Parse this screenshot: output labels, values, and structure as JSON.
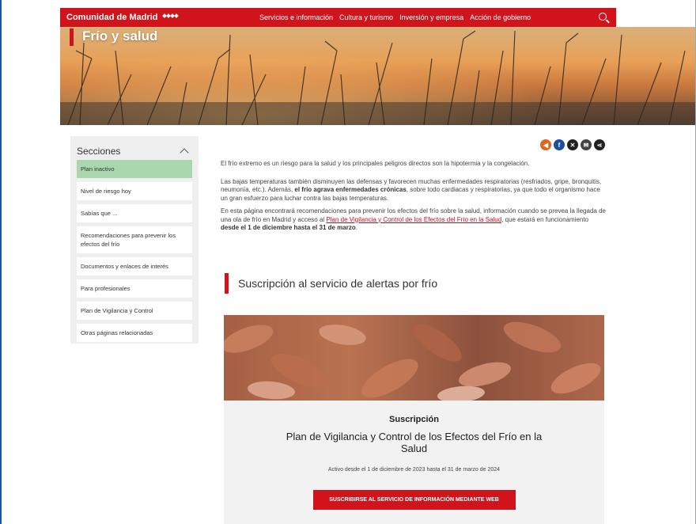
{
  "header": {
    "brand": "Comunidad de Madrid",
    "nav": [
      "Servicios e información",
      "Cultura y turismo",
      "Inversión y empresa",
      "Acción de gobierno"
    ]
  },
  "hero": {
    "title": "Frío y salud"
  },
  "sidebar": {
    "title": "Secciones",
    "items": [
      "Plan inactivo",
      "Nivel de riesgo hoy",
      "Sabías que ...",
      "Recomendaciones para prevenir los efectos del frío",
      "Documentos y enlaces de interés",
      "Para profesionales",
      "Plan de Vigilancia y Control",
      "Otras páginas relacionadas"
    ]
  },
  "content": {
    "p1": "El frío extremo es un riesgo para la salud y los principales peligros directos son la hipotermia y la congelación.",
    "p2_a": "Las bajas temperaturas también disminuyen las defensas y favorecen muchas enfermedades respiratorias (resfriados, gripe, bronquitis, neumonía, etc.). Además, ",
    "p2_b": "el frío agrava enfermedades crónicas",
    "p2_c": ", sobre todo cardiacas y respiratorias, ya que todo el organismo hace un gran esfuerzo para luchar contra las bajas temperaturas.",
    "p3_a": "En esta página encontrará recomendaciones para prevenir los efectos del frío sobre la salud, información cuando se prevea la llegada de una ola de frío en Madrid y acceso al ",
    "p3_link": "Plan de Vigilancia y Control de los Efectos del Frío en la Salud",
    "p3_b": ", que estará en funcionamiento ",
    "p3_c": "desde el 1 de diciembre hasta el 31 de marzo",
    "p3_d": ".",
    "subscription_title": "Suscripción al servicio de alertas por frío"
  },
  "card": {
    "kicker": "Suscripción",
    "title": "Plan de Vigilancia y Control de los Efectos del Frío en la Salud",
    "dates": "Activo desde el 1 de diciembre de 2023 hasta el 31 de marzo de 2024",
    "button": "SUSCRIBIRSE AL SERVICIO DE INFORMACIÓN MEDIANTE WEB"
  },
  "colors": {
    "brand_red": "#d1141c",
    "active_item": "#a9d7ae"
  },
  "icons": [
    "search-icon",
    "chevron-up-icon",
    "audio-icon",
    "facebook-icon",
    "x-icon",
    "email-icon",
    "share-icon"
  ]
}
